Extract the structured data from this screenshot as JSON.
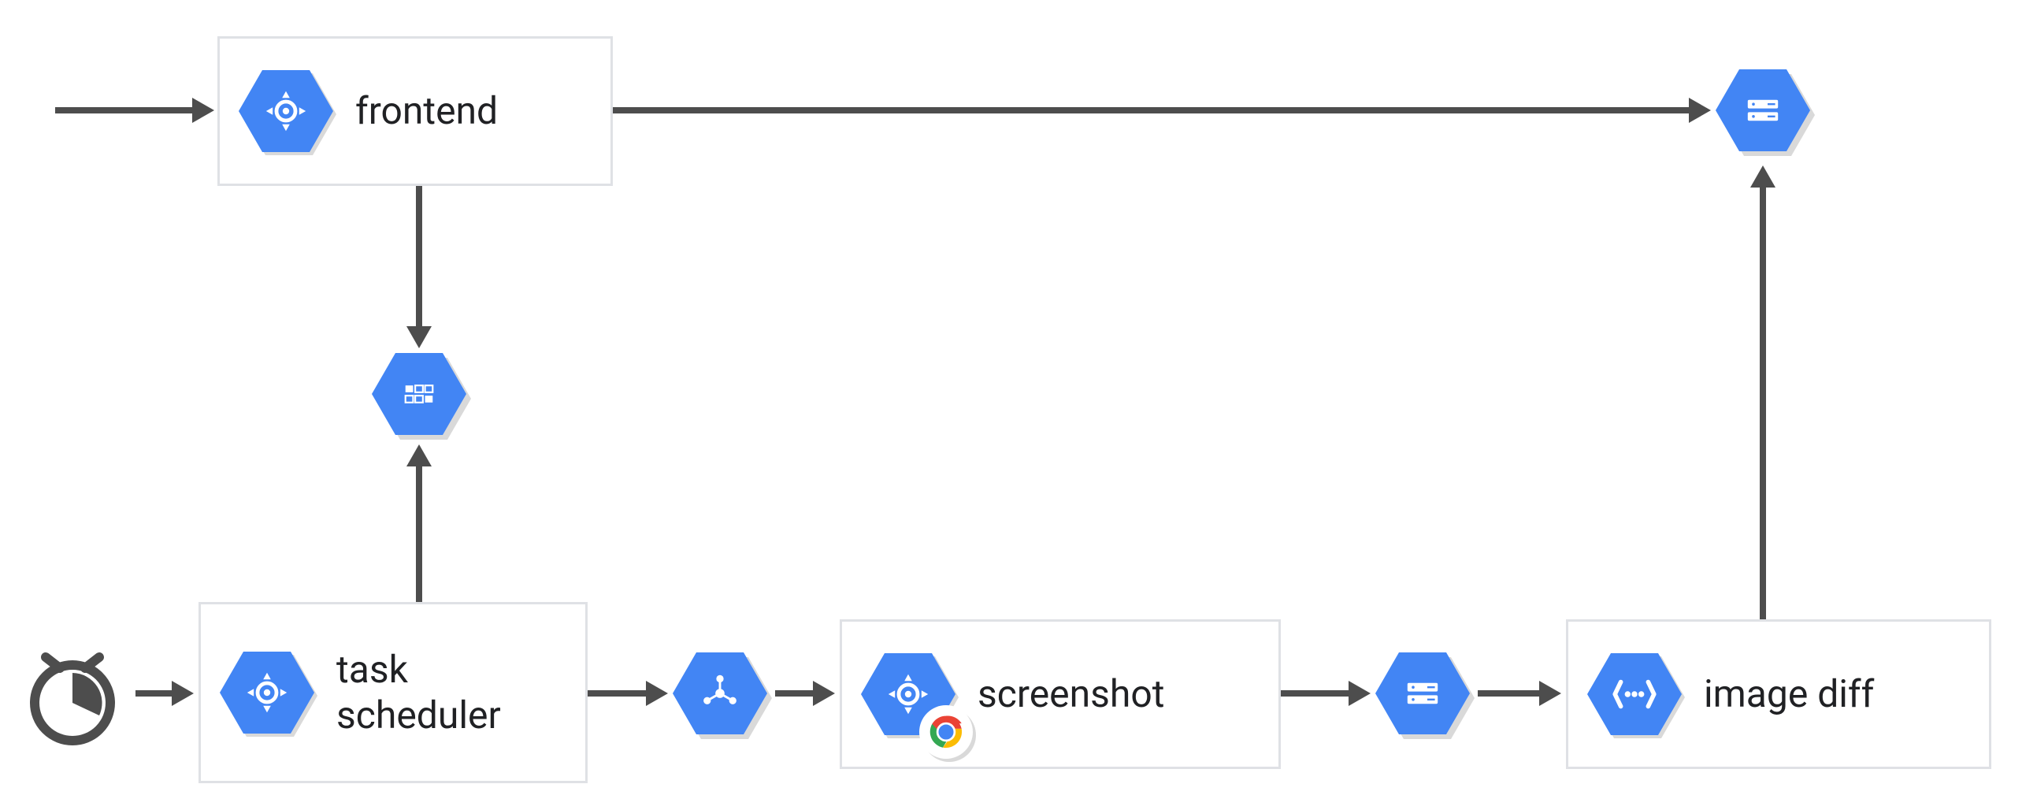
{
  "diagram": {
    "nodes": {
      "frontend": {
        "label": "frontend",
        "icon": "cloud-run"
      },
      "task_scheduler": {
        "label": "task\nscheduler",
        "icon": "cloud-run"
      },
      "screenshot": {
        "label": "screenshot",
        "icon": "cloud-run",
        "badge": "chrome"
      },
      "image_diff": {
        "label": "image diff",
        "icon": "cloud-functions"
      }
    },
    "standalone_icons": {
      "clock": "scheduler-clock",
      "tasks_mid": "cloud-tasks",
      "pubsub": "pubsub",
      "storage_mid": "cloud-storage",
      "storage_top": "cloud-storage"
    },
    "edges": [
      {
        "from": "entry",
        "to": "frontend"
      },
      {
        "from": "frontend",
        "to": "storage_top"
      },
      {
        "from": "frontend",
        "to": "tasks_mid"
      },
      {
        "from": "tasks_mid",
        "to": "task_scheduler"
      },
      {
        "from": "clock",
        "to": "task_scheduler"
      },
      {
        "from": "task_scheduler",
        "to": "pubsub"
      },
      {
        "from": "pubsub",
        "to": "screenshot"
      },
      {
        "from": "screenshot",
        "to": "storage_mid"
      },
      {
        "from": "storage_mid",
        "to": "image_diff"
      },
      {
        "from": "image_diff",
        "to": "storage_top"
      }
    ],
    "colors": {
      "gcp_blue": "#4285f4",
      "box_border": "#dfe1e5",
      "arrow": "#4d4d4d"
    }
  }
}
